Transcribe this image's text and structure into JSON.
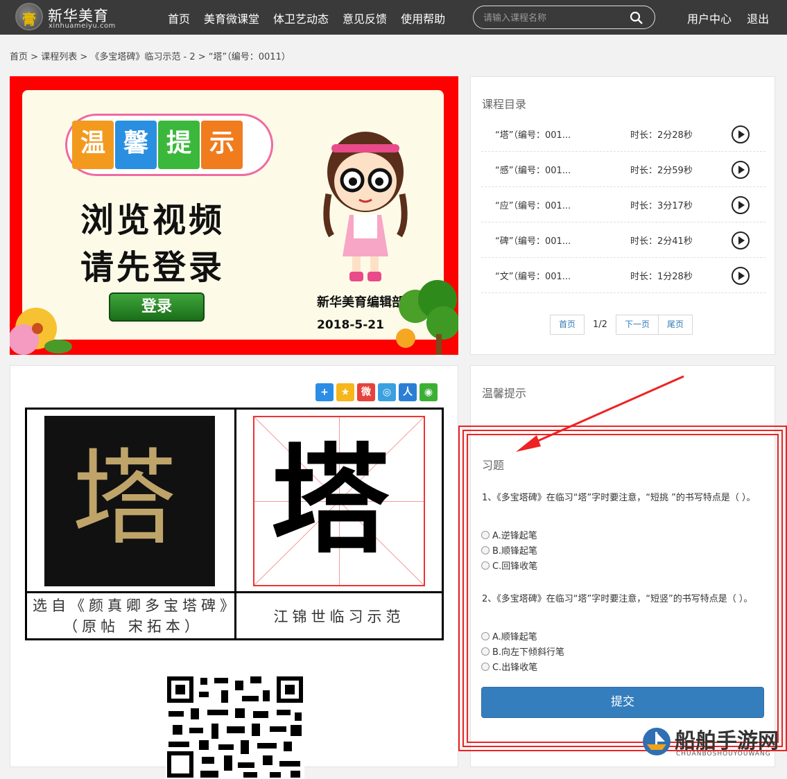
{
  "header": {
    "logo_title": "新华美育",
    "logo_sub": "xinhuameiyu.com",
    "nav": [
      "首页",
      "美育微课堂",
      "体卫艺动态",
      "意见反馈",
      "使用帮助"
    ],
    "search_placeholder": "请输入课程名称",
    "user_links": [
      "用户中心",
      "退出"
    ]
  },
  "breadcrumb": [
    "首页",
    "课程列表",
    "《多宝塔碑》临习示范 - 2",
    "“塔”（编号：0011）"
  ],
  "banner": {
    "tiles": [
      "温",
      "馨",
      "提",
      "示"
    ],
    "line1": "浏览视频",
    "line2": "请先登录",
    "login": "登录",
    "editor": "新华美育编辑部",
    "date": "2018-5-21"
  },
  "catalog": {
    "title": "课程目录",
    "items": [
      {
        "name": "“塔”（编号：001...",
        "duration": "时长：2分28秒"
      },
      {
        "name": "“感”（编号：001...",
        "duration": "时长：2分59秒"
      },
      {
        "name": "“应”（编号：001...",
        "duration": "时长：3分17秒"
      },
      {
        "name": "“碑”（编号：001...",
        "duration": "时长：2分41秒"
      },
      {
        "name": "“文”（编号：001...",
        "duration": "时长：1分28秒"
      }
    ],
    "pager": {
      "first": "首页",
      "page": "1/2",
      "next": "下一页",
      "last": "尾页"
    }
  },
  "calligraphy": {
    "char": "塔",
    "caption_left_1": "选自《颜真卿多宝塔碑》",
    "caption_left_2": "（原帖  宋拓本）",
    "caption_right": "江锦世临习示范"
  },
  "tips": {
    "title": "温馨提示",
    "exercise_title": "习题",
    "questions": [
      {
        "text": "1、《多宝塔碑》在临习“塔”字时要注意，“短挑 ”的书写特点是（ ）。",
        "options": [
          "A.逆锋起笔",
          "B.顺锋起笔",
          "C.回锋收笔"
        ]
      },
      {
        "text": "2、《多宝塔碑》在临习“塔”字时要注意，“短竖”的书写特点是（ ）。",
        "options": [
          "A.顺锋起笔",
          "B.向左下倾斜行笔",
          "C.出锋收笔"
        ]
      }
    ],
    "submit": "提交"
  },
  "watermark": {
    "title": "船舶手游网",
    "sub": "CHUANBOSHOUYOUWANG"
  },
  "colors": {
    "topbar": "#3a3a3a",
    "banner_red": "#ff0000",
    "submit_blue": "#357ebd",
    "annotation_red": "#e22222"
  }
}
